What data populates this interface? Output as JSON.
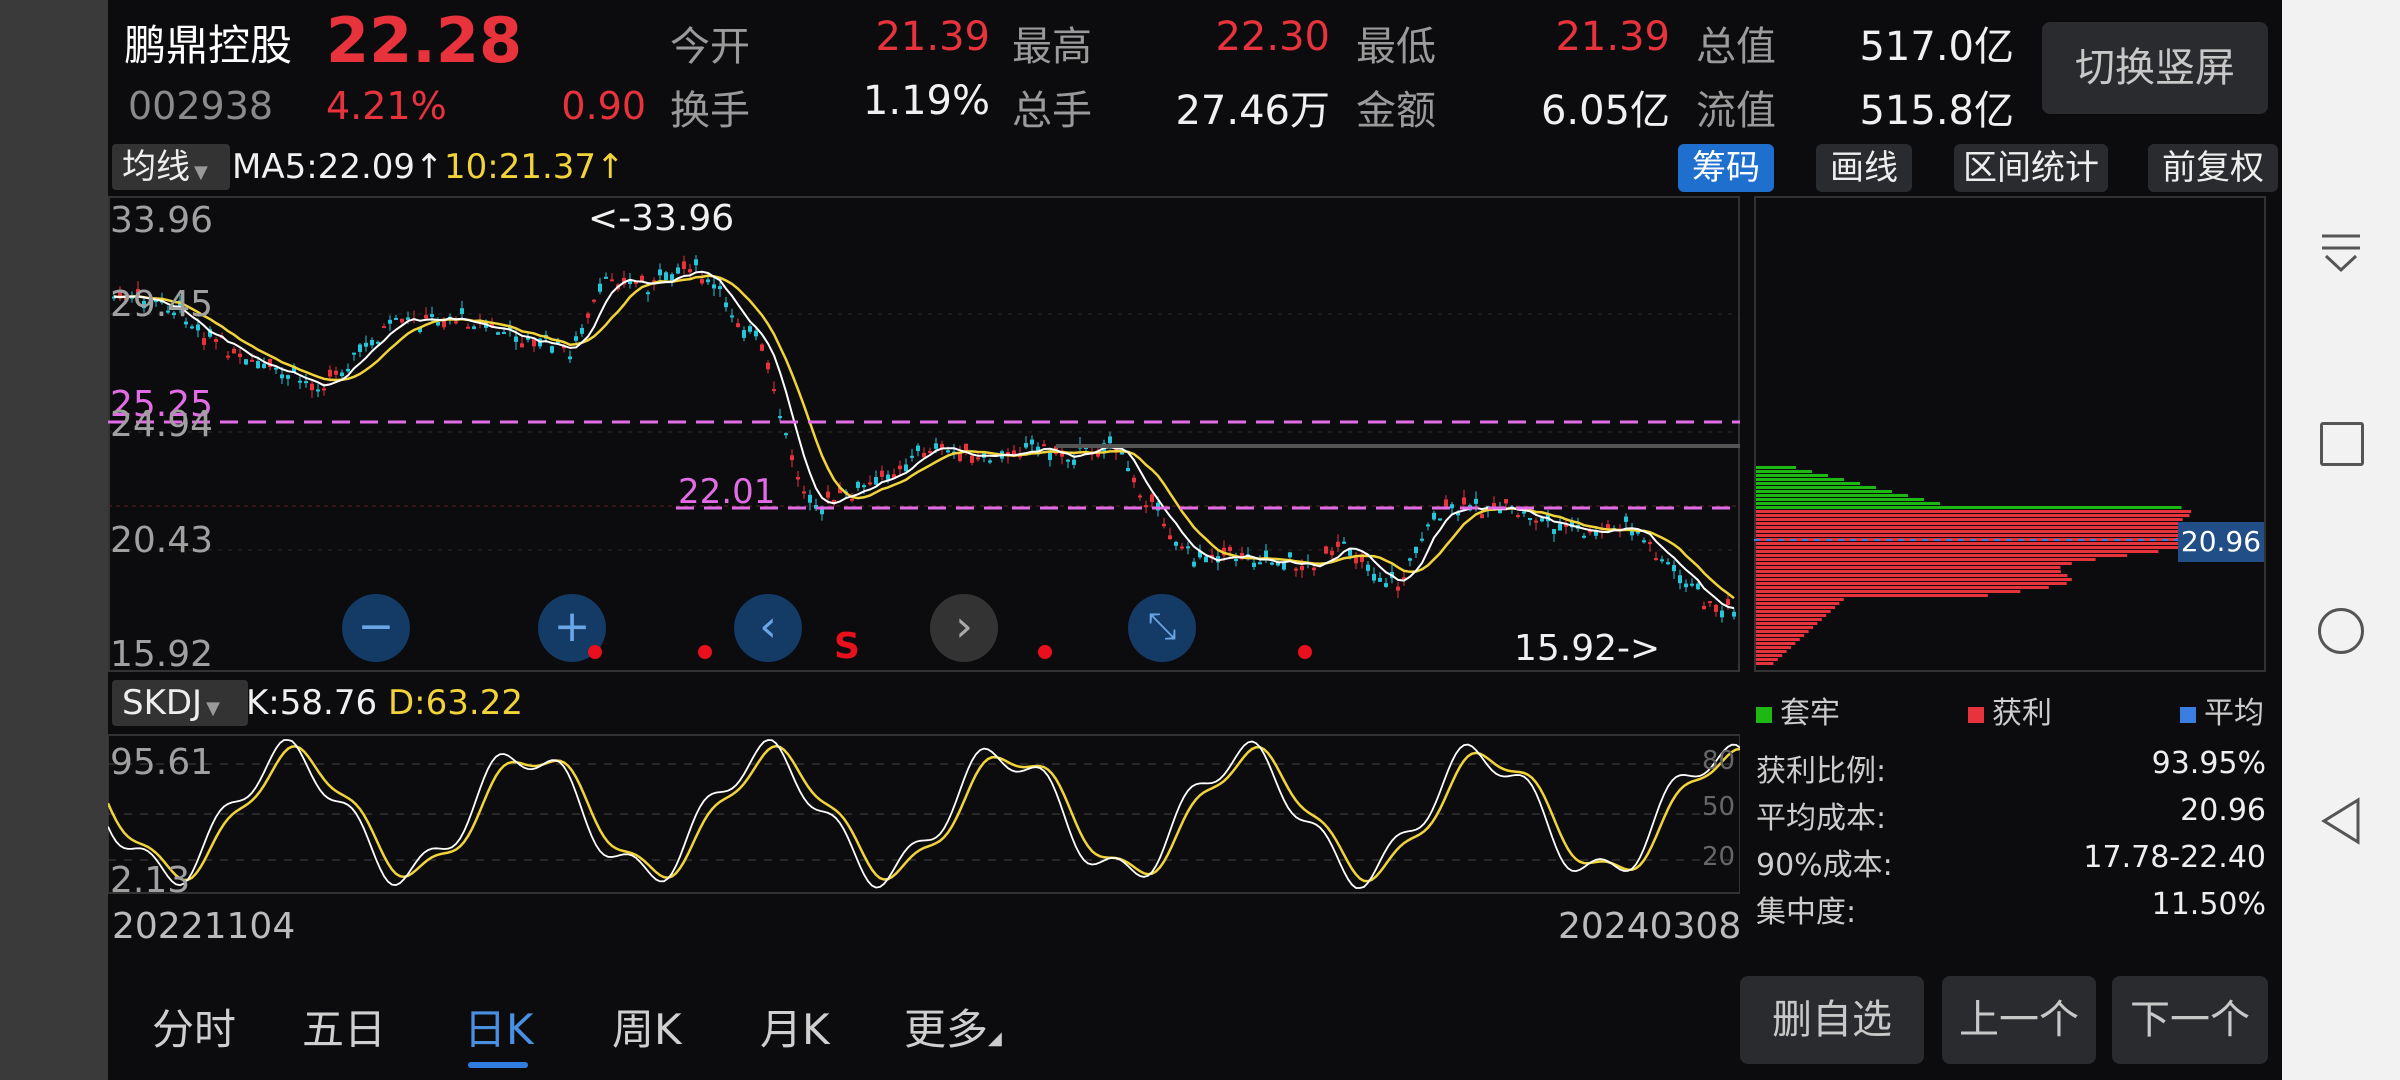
{
  "header": {
    "stock_name": "鹏鼎控股",
    "price": "22.28",
    "code": "002938",
    "change_pct": "4.21%",
    "change_abs": "0.90",
    "switch_button": "切换竖屏",
    "quotes": [
      {
        "label": "今开",
        "value": "21.39"
      },
      {
        "label": "最高",
        "value": "22.30"
      },
      {
        "label": "最低",
        "value": "21.39"
      },
      {
        "label": "总值",
        "value": "517.0亿"
      },
      {
        "label": "换手",
        "value": "1.19%"
      },
      {
        "label": "总手",
        "value": "27.46万"
      },
      {
        "label": "金额",
        "value": "6.05亿"
      },
      {
        "label": "流值",
        "value": "515.8亿"
      }
    ]
  },
  "kline": {
    "indicator_select": "均线",
    "ma5": "MA5:22.09",
    "ma10": "10:21.37",
    "buttons": [
      "筹码",
      "画线",
      "区间统计",
      "前复权"
    ],
    "price_labels": [
      "33.96",
      "29.45",
      "25.25",
      "24.94",
      "20.43",
      "15.92"
    ],
    "max_marker": "<-33.96",
    "min_marker": "15.92->",
    "line_label": "22.01",
    "s_marker": "S"
  },
  "skdj": {
    "indicator_select": "SKDJ",
    "k": "K:58.76",
    "d": "D:63.22",
    "labels": [
      "95.61",
      "2.13"
    ],
    "levels": [
      "80",
      "50",
      "20"
    ]
  },
  "dates": {
    "start": "20221104",
    "end": "20240308"
  },
  "chip": {
    "avg_label": "20.96",
    "legend": [
      "套牢",
      "获利",
      "平均"
    ],
    "stats": [
      {
        "label": "获利比例:",
        "value": "93.95%"
      },
      {
        "label": "平均成本:",
        "value": "20.96"
      },
      {
        "label": "90%成本:",
        "value": "17.78-22.40"
      },
      {
        "label": "集中度:",
        "value": "11.50%"
      }
    ]
  },
  "tabs": [
    "分时",
    "五日",
    "日K",
    "周K",
    "月K",
    "更多"
  ],
  "actions": [
    "删自选",
    "上一个",
    "下一个"
  ],
  "colors": {
    "up": "#e8323c",
    "down": "#26c6da",
    "ma5": "#ffffff",
    "ma10": "#f2d43a",
    "accent": "#1f6fcf",
    "loss": "#1db814"
  }
}
